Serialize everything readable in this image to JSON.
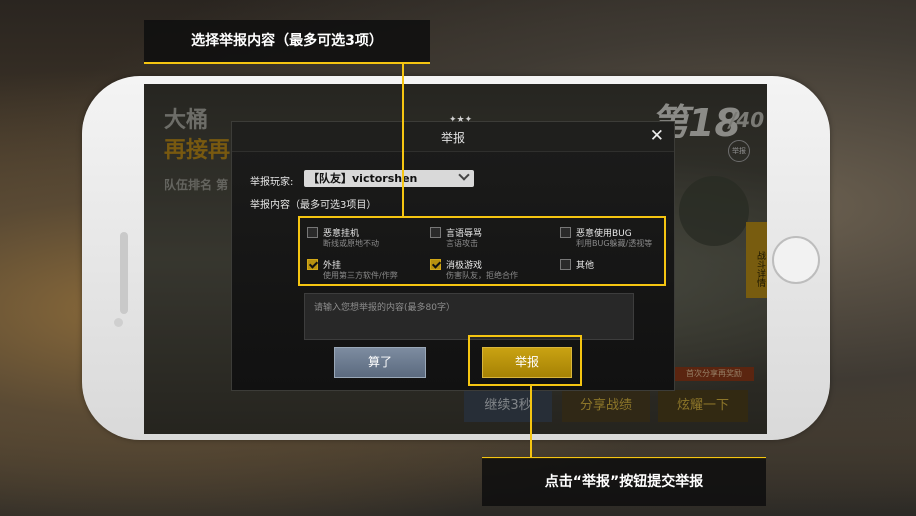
{
  "callouts": {
    "top": "选择举报内容（最多可选3项）",
    "bottom": "点击“举报”按钮提交举报"
  },
  "background_game": {
    "title_line1": "大桶",
    "title_line2": "再接再",
    "team_rank": "队伍排名  第",
    "place": "第18",
    "total": "/40",
    "side_tab": "战斗详情",
    "share_badge": "首次分享再奖励",
    "buttons": [
      "继续3秒",
      "分享战绩",
      "炫耀一下"
    ]
  },
  "dialog": {
    "title": "举报",
    "close_icon": "close-icon",
    "player_label": "举报玩家:",
    "player_value": "【队友】victorshen",
    "content_label": "举报内容（最多可选3项目）",
    "options": [
      {
        "title": "恶意挂机",
        "sub": "断线或原地不动",
        "checked": false
      },
      {
        "title": "言语辱骂",
        "sub": "言语攻击",
        "checked": false
      },
      {
        "title": "恶意使用BUG",
        "sub": "利用BUG躲藏/透视等",
        "checked": false
      },
      {
        "title": "外挂",
        "sub": "使用第三方软件/作弊",
        "checked": true
      },
      {
        "title": "消极游戏",
        "sub": "伤害队友，拒绝合作",
        "checked": true
      },
      {
        "title": "其他",
        "sub": "",
        "checked": false
      }
    ],
    "textarea_placeholder": "请输入您想举报的内容(最多80字）",
    "cancel_label": "算了",
    "report_label": "举报"
  },
  "colors": {
    "highlight": "#f5c511",
    "report_button": "#b8920c",
    "cancel_button": "#6b7a8f"
  }
}
